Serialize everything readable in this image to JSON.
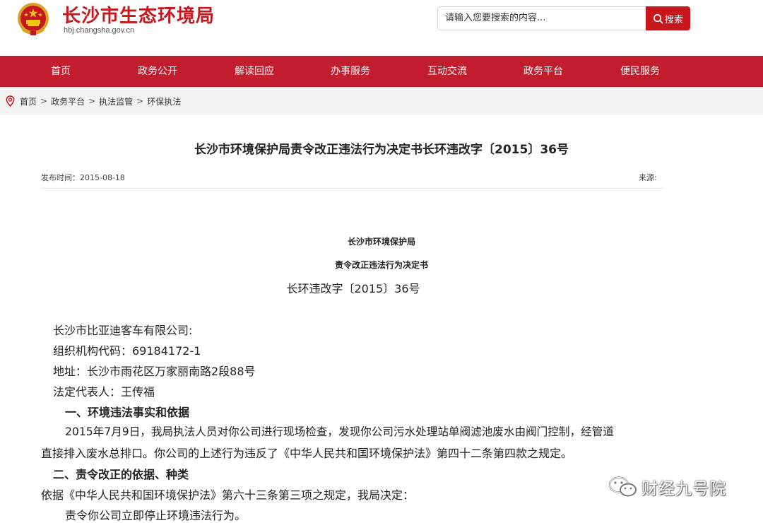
{
  "header": {
    "title": "长沙市生态环境局",
    "url": "hbj.changsha.gov.cn",
    "search_placeholder": "请输入您要搜索的内容...",
    "search_button": "搜索"
  },
  "nav": {
    "items": [
      "首页",
      "政务公开",
      "解读回应",
      "办事服务",
      "互动交流",
      "政务平台",
      "便民服务"
    ]
  },
  "breadcrumb": {
    "items": [
      "首页",
      "政务平台",
      "执法监管",
      "环保执法"
    ],
    "separator": ">"
  },
  "article": {
    "title": "长沙市环境保护局责令改正违法行为决定书长环违改字〔2015〕36号",
    "publish_time": "发布时间：2015-08-18",
    "source": "来源:",
    "doc_org": "长沙市环境保护局",
    "doc_type": "责令改正违法行为决定书",
    "doc_number": "长环违改字〔2015〕36号",
    "lines": [
      "长沙市比亚迪客车有限公司:",
      "组织机构代码：69184172-1",
      "地址：长沙市雨花区万家丽南路2段88号",
      "法定代表人：王传福",
      "一、环境违法事实和依据",
      "2015年7月9日，我局执法人员对你公司进行现场检查，发现你公司污水处理站单阀滤池废水由阀门控制，经管道",
      "直接排入废水总排口。你公司的上述行为违反了《中华人民共和国环境保护法》第四十二条第四款之规定。",
      "二、责令改正的依据、种类",
      "依据《中华人民共和国环境保护法》第六十三条第三项之规定，我局决定：",
      "责令你公司立即停止环境违法行为。"
    ]
  },
  "watermark": {
    "text": "财经九号院"
  },
  "colors": {
    "brand_red": "#c8161d",
    "nav_red": "#c11d2c",
    "breadcrumb_bg": "#f3f3f3"
  }
}
